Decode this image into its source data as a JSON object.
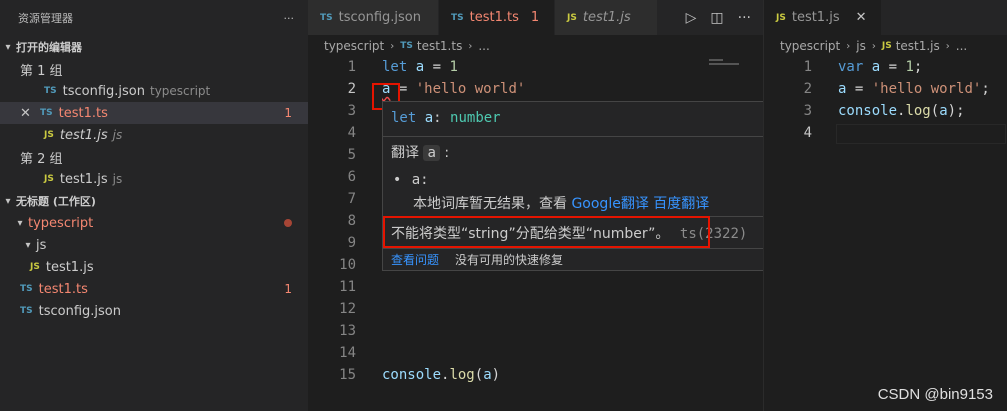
{
  "sidebar": {
    "title": "资源管理器",
    "more": "···",
    "open_editors": "打开的编辑器",
    "group1": "第 1 组",
    "group2": "第 2 组",
    "items": [
      {
        "name": "tsconfig.json",
        "desc": "typescript"
      },
      {
        "name": "test1.ts",
        "badge": "1"
      },
      {
        "name": "test1.js",
        "desc": "js"
      },
      {
        "name": "test1.js",
        "desc": "js"
      }
    ],
    "workspace": "无标题 (工作区)",
    "tree": [
      "typescript",
      "js",
      "test1.js",
      "test1.ts",
      "tsconfig.json"
    ],
    "tree_badge": "1"
  },
  "editor1": {
    "tabs": [
      {
        "label": "tsconfig.json",
        "icon": "TS"
      },
      {
        "label": "test1.ts",
        "icon": "TS",
        "badge": "1"
      },
      {
        "label": "test1.js",
        "icon": "JS"
      }
    ],
    "breadcrumbs": [
      "typescript",
      "test1.ts",
      "..."
    ],
    "line_numbers": [
      "1",
      "2",
      "3",
      "4",
      "5",
      "6",
      "7",
      "8",
      "9",
      "10",
      "11",
      "12",
      "13",
      "14",
      "15"
    ],
    "code": {
      "l1_kw": "let",
      "l1_var": "a",
      "l1_eq": " = ",
      "l1_num": "1",
      "l2_var": "a",
      "l2_eq": " = ",
      "l2_str": "'hello world'",
      "l15_obj": "console",
      "l15_fn": "log",
      "l15_arg": "a"
    }
  },
  "hover": {
    "sig_kw": "let",
    "sig_var": "a",
    "sig_type": "number",
    "translate_label": "翻译",
    "translate_word": "a",
    "colon": ":",
    "bullet_word": "a:",
    "no_result": "本地词库暂无结果，查看",
    "google": "Google翻译",
    "baidu": "百度翻译",
    "error": "不能将类型“string”分配给类型“number”。",
    "error_code": "ts(2322)",
    "view_problem": "查看问题",
    "no_fix": "没有可用的快速修复"
  },
  "editor2": {
    "tab": "test1.js",
    "breadcrumbs": [
      "typescript",
      "js",
      "test1.js",
      "..."
    ],
    "line_numbers": [
      "1",
      "2",
      "3",
      "4"
    ],
    "code": {
      "l1_kw": "var",
      "l1_var": "a",
      "l1_eq": " = ",
      "l1_num": "1",
      "l1_end": ";",
      "l2_var": "a",
      "l2_eq": " = ",
      "l2_str": "'hello world'",
      "l2_end": ";",
      "l3_obj": "console",
      "l3_fn": "log",
      "l3_arg": "a",
      "l3_end": ";"
    }
  },
  "watermark": "CSDN @bin9153",
  "colors": {
    "error": "#f14c4c",
    "highlight_box": "#e51400",
    "link": "#3794ff"
  }
}
